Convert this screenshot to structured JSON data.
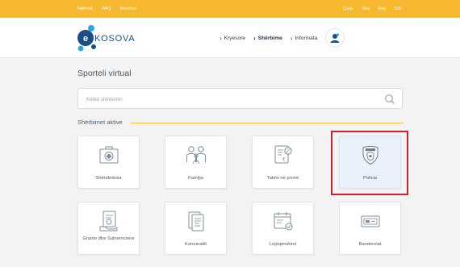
{
  "colors": {
    "topbar": "#f5b82e",
    "accent": "#f3bf3d",
    "brand": "#1d4d86",
    "highlight_border": "#d61e2a",
    "highlight_card": "#e9f1fb"
  },
  "topbar": {
    "left_links": [
      "Ndihmë",
      "FAQ",
      "Webinar"
    ],
    "right_links": [
      "Qyqu",
      "Shq",
      "Eng",
      "Srb"
    ]
  },
  "header": {
    "logo_text": "KOSOVA",
    "logo_icon": "e-logo-icon",
    "nav": [
      {
        "label": "Kryesore",
        "active": false
      },
      {
        "label": "Shërbime",
        "active": true
      },
      {
        "label": "Informata",
        "active": false
      }
    ],
    "user_icon": "user-avatar-icon"
  },
  "main": {
    "title": "Sporteli virtual",
    "search": {
      "placeholder": "Kërko shërbimin",
      "value": ""
    },
    "section_title": "Shërbimet aktive",
    "cards": [
      {
        "label": "Shëndetësia",
        "icon": "health-kit-icon",
        "highlighted": false
      },
      {
        "label": "Familja",
        "icon": "family-icon",
        "highlighted": false
      },
      {
        "label": "Tatimi në pronë",
        "icon": "tax-document-icon",
        "highlighted": false
      },
      {
        "label": "Policia",
        "icon": "police-badge-icon",
        "highlighted": true
      },
      {
        "label": "Grante dhe Subvencione",
        "icon": "grant-document-icon",
        "highlighted": false
      },
      {
        "label": "Komunaliti",
        "icon": "utility-bill-icon",
        "highlighted": false
      },
      {
        "label": "Lejeqëndrimi",
        "icon": "residence-permit-icon",
        "highlighted": false
      },
      {
        "label": "Banderolat",
        "icon": "banderol-icon",
        "highlighted": false
      }
    ]
  }
}
